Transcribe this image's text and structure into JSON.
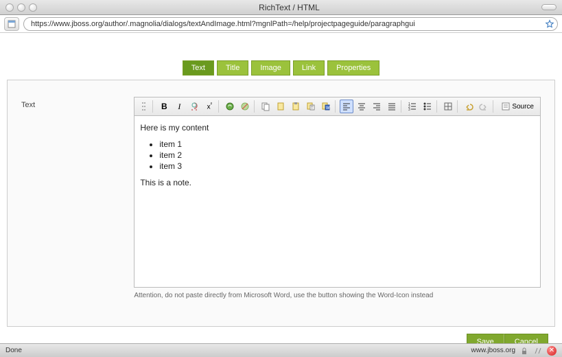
{
  "window": {
    "title": "RichText / HTML"
  },
  "url": "https://www.jboss.org/author/.magnolia/dialogs/textAndImage.html?mgnlPath=/help/projectpageguide/paragraphgui",
  "tabs": [
    {
      "label": "Text",
      "active": true
    },
    {
      "label": "Title"
    },
    {
      "label": "Image"
    },
    {
      "label": "Link"
    },
    {
      "label": "Properties"
    }
  ],
  "field_label": "Text",
  "toolbar": {
    "bold": "B",
    "italic": "I",
    "source": "Source"
  },
  "content": {
    "para1": "Here is my content",
    "items": [
      "item 1",
      "item 2",
      "item 3"
    ],
    "para2": "This is a note."
  },
  "hint": "Attention, do not paste directly from Microsoft Word, use the button showing the Word-Icon instead",
  "buttons": {
    "save": "Save",
    "cancel": "Cancel"
  },
  "status": {
    "left": "Done",
    "host": "www.jboss.org"
  }
}
